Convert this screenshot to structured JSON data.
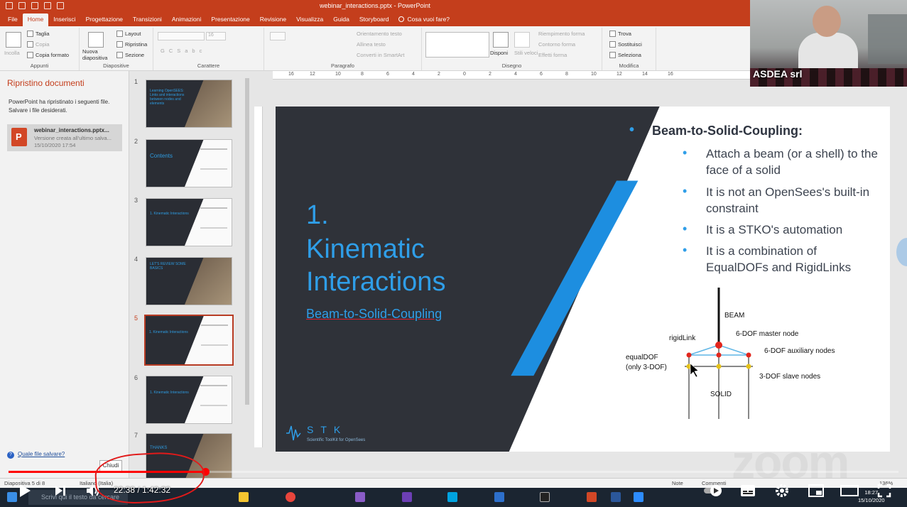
{
  "window": {
    "title": "webinar_interactions.pptx  -  PowerPoint"
  },
  "ribbon_tabs": [
    "File",
    "Home",
    "Inserisci",
    "Progettazione",
    "Transizioni",
    "Animazioni",
    "Presentazione",
    "Revisione",
    "Visualizza",
    "Guida",
    "Storyboard",
    "Cosa vuoi fare?"
  ],
  "ribbon": {
    "appunti": {
      "label": "Appunti",
      "incolla": "Incolla",
      "taglia": "Taglia",
      "copia": "Copia",
      "copia_formato": "Copia formato"
    },
    "diapositive": {
      "label": "Diapositive",
      "nuova": "Nuova diapositiva",
      "layout": "Layout",
      "ripristina": "Ripristina",
      "sezione": "Sezione"
    },
    "carattere": {
      "label": "Carattere",
      "size": "16"
    },
    "paragrafo": {
      "label": "Paragrafo",
      "orientamento": "Orientamento testo",
      "allinea": "Allinea testo",
      "converti": "Converti in SmartArt"
    },
    "disegno": {
      "label": "Disegno",
      "disponi": "Disponi",
      "stili": "Stili veloci",
      "riempimento": "Riempimento forma",
      "contorno": "Contorno forma",
      "effetti": "Effetti forma"
    },
    "modifica": {
      "label": "Modifica",
      "trova": "Trova",
      "sostituisci": "Sostituisci",
      "seleziona": "Seleziona"
    }
  },
  "recovery": {
    "title": "Ripristino documenti",
    "message": "PowerPoint ha ripristinato i seguenti file. Salvare i file desiderati.",
    "file_name": "webinar_interactions.pptx...",
    "file_desc": "Versione creata all'ultimo salva...",
    "file_date": "15/10/2020 17:54",
    "help_link": "Quale file salvare?",
    "close_button": "Chiudi"
  },
  "thumbnails": [
    {
      "num": "1",
      "text": "Learning OpenSEES: Links and interactions between nodes and elements"
    },
    {
      "num": "2",
      "text": "Contents"
    },
    {
      "num": "3",
      "text": "1. Kinematic Interactions"
    },
    {
      "num": "4",
      "text": "LET'S REVIEW SOME BASICS"
    },
    {
      "num": "5",
      "text": "1. Kinematic Interactions"
    },
    {
      "num": "6",
      "text": "1. Kinematic Interactions"
    },
    {
      "num": "7",
      "text": "THANKS"
    }
  ],
  "ruler_ticks": [
    "16",
    "12",
    "10",
    "8",
    "6",
    "4",
    "2",
    "0",
    "2",
    "4",
    "6",
    "8",
    "10",
    "12",
    "14",
    "16"
  ],
  "slide": {
    "number": "1.",
    "title": "Kinematic Interactions",
    "subtitle": "Beam-to-Solid-Coupling",
    "logo_name": "STK",
    "logo_tagline": "Scientific ToolKit for OpenSees",
    "main_bullet": "Beam-to-Solid-Coupling:",
    "bullets": [
      "Attach a beam (or a shell) to the face of a solid",
      "It is not an OpenSees's built-in constraint",
      "It is a STKO's automation",
      "It is a combination of EqualDOFs and RigidLinks"
    ],
    "diagram": {
      "beam": "BEAM",
      "rigid_link": "rigidLink",
      "master": "6-DOF master node",
      "auxiliary": "6-DOF auxiliary nodes",
      "equaldof_1": "equalDOF",
      "equaldof_2": "(only 3-DOF)",
      "slave": "3-DOF slave nodes",
      "solid": "SOLID"
    }
  },
  "webcam": {
    "label": "ASDEA srl"
  },
  "statusbar": {
    "slide_info": "Diapositiva 5 di 8",
    "language": "Italiano (Italia)",
    "notes": "Note",
    "comments": "Commenti",
    "zoom": "136%"
  },
  "taskbar": {
    "search_placeholder": "Scrivi qui il testo da cercare",
    "time": "18:27",
    "date": "15/10/2020"
  },
  "player": {
    "time": "22:38 / 1:42:32",
    "progress": 0.221,
    "watermark": "zoom"
  },
  "colors": {
    "ppt_red": "#c43e1c",
    "accent_blue": "#2f9ee8",
    "slide_dark": "#2f3239",
    "yt_red": "#ff0000"
  }
}
